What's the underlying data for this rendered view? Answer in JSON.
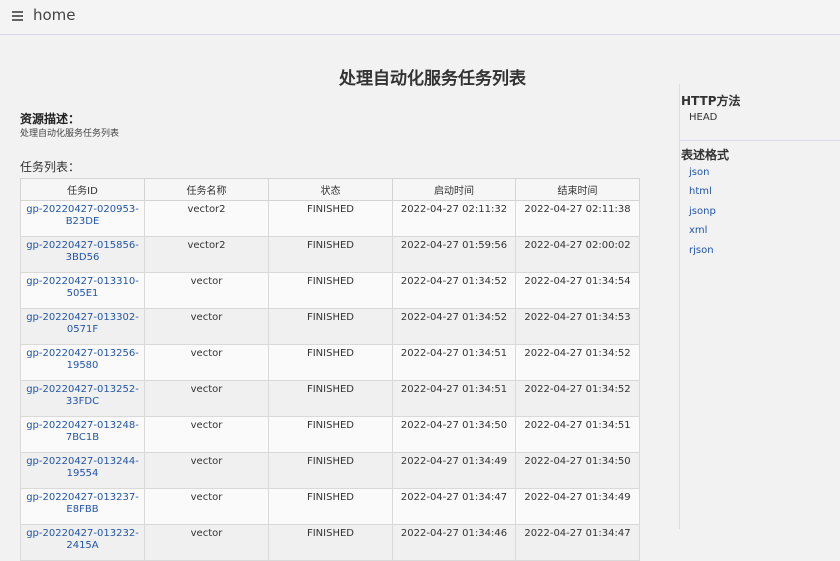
{
  "header": {
    "title": "home"
  },
  "page": {
    "title": "处理自动化服务任务列表"
  },
  "resource": {
    "label": "资源描述：",
    "description": "处理自动化服务任务列表"
  },
  "tasks": {
    "label": "任务列表：",
    "columns": [
      "任务ID",
      "任务名称",
      "状态",
      "启动时间",
      "结束时间"
    ],
    "rows": [
      [
        "gp-20220427-020953-B23DE",
        "vector2",
        "FINISHED",
        "2022-04-27 02:11:32",
        "2022-04-27 02:11:38"
      ],
      [
        "gp-20220427-015856-3BD56",
        "vector2",
        "FINISHED",
        "2022-04-27 01:59:56",
        "2022-04-27 02:00:02"
      ],
      [
        "gp-20220427-013310-505E1",
        "vector",
        "FINISHED",
        "2022-04-27 01:34:52",
        "2022-04-27 01:34:54"
      ],
      [
        "gp-20220427-013302-0571F",
        "vector",
        "FINISHED",
        "2022-04-27 01:34:52",
        "2022-04-27 01:34:53"
      ],
      [
        "gp-20220427-013256-19580",
        "vector",
        "FINISHED",
        "2022-04-27 01:34:51",
        "2022-04-27 01:34:52"
      ],
      [
        "gp-20220427-013252-33FDC",
        "vector",
        "FINISHED",
        "2022-04-27 01:34:51",
        "2022-04-27 01:34:52"
      ],
      [
        "gp-20220427-013248-7BC1B",
        "vector",
        "FINISHED",
        "2022-04-27 01:34:50",
        "2022-04-27 01:34:51"
      ],
      [
        "gp-20220427-013244-19554",
        "vector",
        "FINISHED",
        "2022-04-27 01:34:49",
        "2022-04-27 01:34:50"
      ],
      [
        "gp-20220427-013237-E8FBB",
        "vector",
        "FINISHED",
        "2022-04-27 01:34:47",
        "2022-04-27 01:34:49"
      ],
      [
        "gp-20220427-013232-2415A",
        "vector",
        "FINISHED",
        "2022-04-27 01:34:46",
        "2022-04-27 01:34:47"
      ]
    ]
  },
  "sidebar": {
    "http_heading": "HTTP方法",
    "http_method": "HEAD",
    "format_heading": "表述格式",
    "formats": [
      "json",
      "html",
      "jsonp",
      "xml",
      "rjson"
    ]
  },
  "icons": {
    "menu": "hamburger-menu-icon"
  },
  "colors": {
    "link": "#2255aa",
    "divider": "#dcdcec"
  }
}
